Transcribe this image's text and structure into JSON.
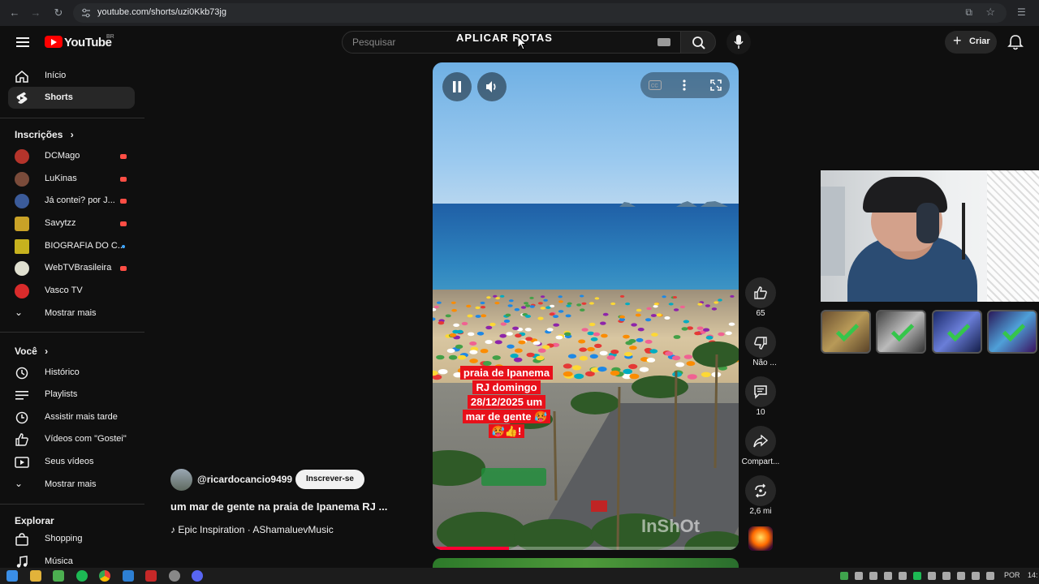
{
  "browser": {
    "url": "youtube.com/shorts/uzi0Kkb73jg"
  },
  "header": {
    "logo_text": "YouTube",
    "region": "BR",
    "search_placeholder": "Pesquisar",
    "overlay_title": "APLICAR ROTAS",
    "create_label": "Criar"
  },
  "sidebar": {
    "main": [
      {
        "label": "Início",
        "icon": "home-icon"
      },
      {
        "label": "Shorts",
        "icon": "shorts-icon",
        "active": true
      }
    ],
    "subscriptions_heading": "Inscrições",
    "subscriptions": [
      {
        "label": "DCMago",
        "color": "#b5342b",
        "live": true
      },
      {
        "label": "LuKinas",
        "color": "#7a4b3a",
        "live": true
      },
      {
        "label": "Já contei? por J...",
        "color": "#3b5b9a",
        "live": true
      },
      {
        "label": "Savytzz",
        "color": "#c9a227",
        "live": true
      },
      {
        "label": "BIOGRAFIA DO C...",
        "color": "#c7b21e",
        "live": false
      },
      {
        "label": "WebTVBrasileira",
        "color": "#e0e0d0",
        "live": true
      },
      {
        "label": "Vasco TV",
        "color": "#d92b2b",
        "live": false
      }
    ],
    "subscriptions_more": "Mostrar mais",
    "you_heading": "Você",
    "you_items": [
      {
        "label": "Histórico",
        "icon": "history-icon"
      },
      {
        "label": "Playlists",
        "icon": "playlists-icon"
      },
      {
        "label": "Assistir mais tarde",
        "icon": "watch-later-icon"
      },
      {
        "label": "Vídeos com \"Gostei\"",
        "icon": "like-icon"
      },
      {
        "label": "Seus vídeos",
        "icon": "your-videos-icon"
      }
    ],
    "you_more": "Mostrar mais",
    "explore_heading": "Explorar",
    "explore_items": [
      {
        "label": "Shopping",
        "icon": "shopping-icon"
      },
      {
        "label": "Música",
        "icon": "music-icon"
      }
    ]
  },
  "short": {
    "caption_lines": [
      "praia de Ipanema",
      "RJ domingo",
      "28/12/2025 um",
      "mar de gente 🥵",
      "🥵👍!"
    ],
    "watermark": "InShOt",
    "progress": 0.25,
    "channel": "@ricardocancio9499",
    "subscribe_label": "Inscrever-se",
    "title": "um mar de gente na praia de Ipanema RJ ...",
    "music": "Epic Inspiration · AShamaluevMusic"
  },
  "actions": {
    "like_count": "65",
    "dislike_label": "Não ...",
    "comments_count": "10",
    "share_label": "Compart...",
    "remix_count": "2,6 mi"
  },
  "taskbar": {
    "language": "POR",
    "clock": "14:"
  }
}
